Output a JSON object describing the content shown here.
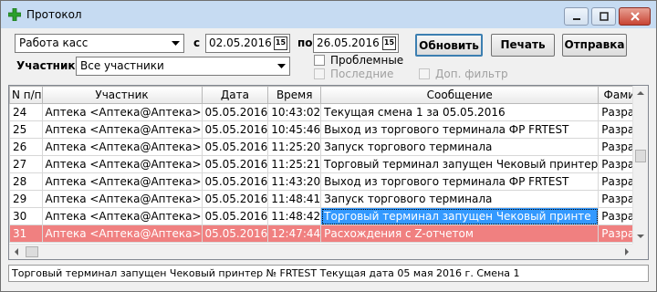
{
  "window": {
    "title": "Протокол"
  },
  "filters": {
    "log_type": "Работа касс",
    "from_label": "с",
    "from_date": "02.05.2016",
    "to_label": "по",
    "to_date": "26.05.2016",
    "participant_label": "Участник",
    "participant": "Все участники",
    "calendar_glyph": "15"
  },
  "buttons": {
    "refresh": "Обновить",
    "print": "Печать",
    "send": "Отправка"
  },
  "checkboxes": {
    "problematic": "Проблемные",
    "latest": "Последние",
    "extra_filter": "Доп. фильтр"
  },
  "table": {
    "columns": [
      "N п/п",
      "Участник",
      "Дата",
      "Время",
      "Сообщение",
      "Фамилия"
    ],
    "rows": [
      [
        "24",
        "Аптека <Аптека@Аптека>",
        "05.05.2016",
        "10:43:02",
        "Текущая смена 1 за 05.05.2016",
        "Разработч"
      ],
      [
        "25",
        "Аптека <Аптека@Аптека>",
        "05.05.2016",
        "10:45:46",
        "Выход из торгового терминала ФР FRTEST",
        "Разработч"
      ],
      [
        "26",
        "Аптека <Аптека@Аптека>",
        "05.05.2016",
        "11:25:20",
        "Запуск торгового терминала",
        "Разработч"
      ],
      [
        "27",
        "Аптека <Аптека@Аптека>",
        "05.05.2016",
        "11:25:21",
        "Торговый терминал запущен  Чековый принтер",
        "Разработч"
      ],
      [
        "28",
        "Аптека <Аптека@Аптека>",
        "05.05.2016",
        "11:43:20",
        "Выход из торгового терминала ФР FRTEST",
        "Разработч"
      ],
      [
        "29",
        "Аптека <Аптека@Аптека>",
        "05.05.2016",
        "11:48:41",
        "Запуск торгового терминала",
        "Разработч"
      ],
      [
        "30",
        "Аптека <Аптека@Аптека>",
        "05.05.2016",
        "11:48:42",
        "Торговый терминал запущен  Чековый принте",
        "Разработч"
      ],
      [
        "31",
        "Аптека <Аптека@Аптека>",
        "05.05.2016",
        "12:47:44",
        "Расхождения с Z-отчетом",
        "Разработч"
      ]
    ],
    "highlight_color": "#f08080",
    "selection_color": "#3399ff"
  },
  "status": {
    "text": "Торговый терминал запущен  Чековый принтер № FRTEST  Текущая дата 05 мая 2016 г.   Смена 1"
  }
}
